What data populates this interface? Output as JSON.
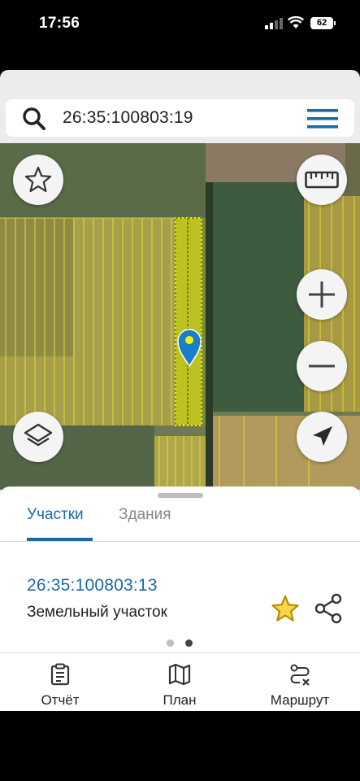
{
  "status_bar": {
    "time": "17:56",
    "battery": "62"
  },
  "search": {
    "value": "26:35:100803:19"
  },
  "map": {
    "marker_color": "#1a7fc6",
    "parcel_highlight_color": "#f2f20a"
  },
  "sheet": {
    "tabs": [
      {
        "label": "Участки",
        "active": true
      },
      {
        "label": "Здания",
        "active": false
      }
    ],
    "result": {
      "number": "26:35:100803:13",
      "type": "Земельный участок"
    },
    "page_indicator": {
      "total": 2,
      "current": 2
    }
  },
  "nav": [
    {
      "label": "Отчёт",
      "icon": "report-icon"
    },
    {
      "label": "План",
      "icon": "map-plan-icon"
    },
    {
      "label": "Маршрут",
      "icon": "route-icon"
    }
  ],
  "colors": {
    "accent": "#1a6aa6",
    "star": "#e0b100"
  }
}
